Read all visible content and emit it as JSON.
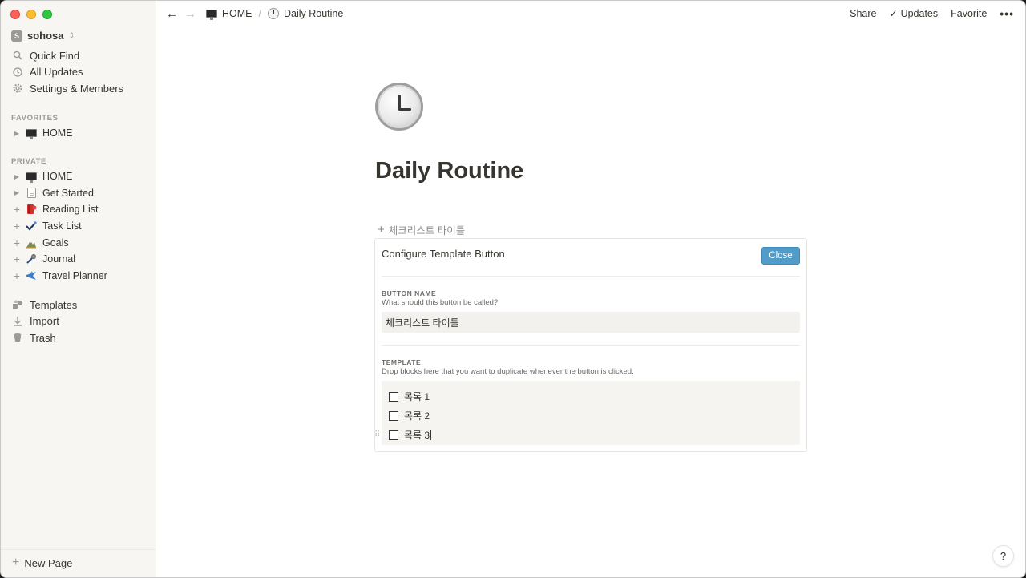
{
  "workspace": {
    "initial": "S",
    "name": "sohosa"
  },
  "nav_top": [
    {
      "label": "Quick Find",
      "icon": "search-icon"
    },
    {
      "label": "All Updates",
      "icon": "clock-icon"
    },
    {
      "label": "Settings & Members",
      "icon": "gear-icon"
    }
  ],
  "favorites": {
    "label": "FAVORITES",
    "items": [
      {
        "label": "HOME",
        "icon": "monitor-icon"
      }
    ]
  },
  "private": {
    "label": "PRIVATE",
    "items": [
      {
        "label": "HOME",
        "icon": "monitor-icon"
      },
      {
        "label": "Get Started",
        "icon": "document-icon"
      },
      {
        "label": "Reading List",
        "icon": "book-icon"
      },
      {
        "label": "Task List",
        "icon": "checkmark-icon"
      },
      {
        "label": "Goals",
        "icon": "mountain-icon"
      },
      {
        "label": "Journal",
        "icon": "microphone-icon"
      },
      {
        "label": "Travel Planner",
        "icon": "airplane-icon"
      }
    ]
  },
  "nav_bottom": [
    {
      "label": "Templates",
      "icon": "shapes-icon"
    },
    {
      "label": "Import",
      "icon": "download-icon"
    },
    {
      "label": "Trash",
      "icon": "trash-icon"
    }
  ],
  "new_page": "New Page",
  "breadcrumb": {
    "parent": "HOME",
    "separator": "/",
    "current": "Daily Routine"
  },
  "top_actions": {
    "share": "Share",
    "updates": "Updates",
    "favorite": "Favorite",
    "more": "•••"
  },
  "page": {
    "title": "Daily Routine",
    "icon": "clock-icon"
  },
  "template_button": {
    "label": "체크리스트 타이틀"
  },
  "config": {
    "title": "Configure Template Button",
    "close": "Close",
    "name_label": "BUTTON NAME",
    "name_help": "What should this button be called?",
    "name_value": "체크리스트 타이틀",
    "template_label": "TEMPLATE",
    "template_help": "Drop blocks here that you want to duplicate whenever the button is clicked.",
    "todos": [
      "목록 1",
      "목록 2",
      "목록 3"
    ]
  },
  "help": "?",
  "colors": {
    "accent": "#529cca",
    "sidebar_bg": "#f7f6f3",
    "text": "#37352f"
  }
}
